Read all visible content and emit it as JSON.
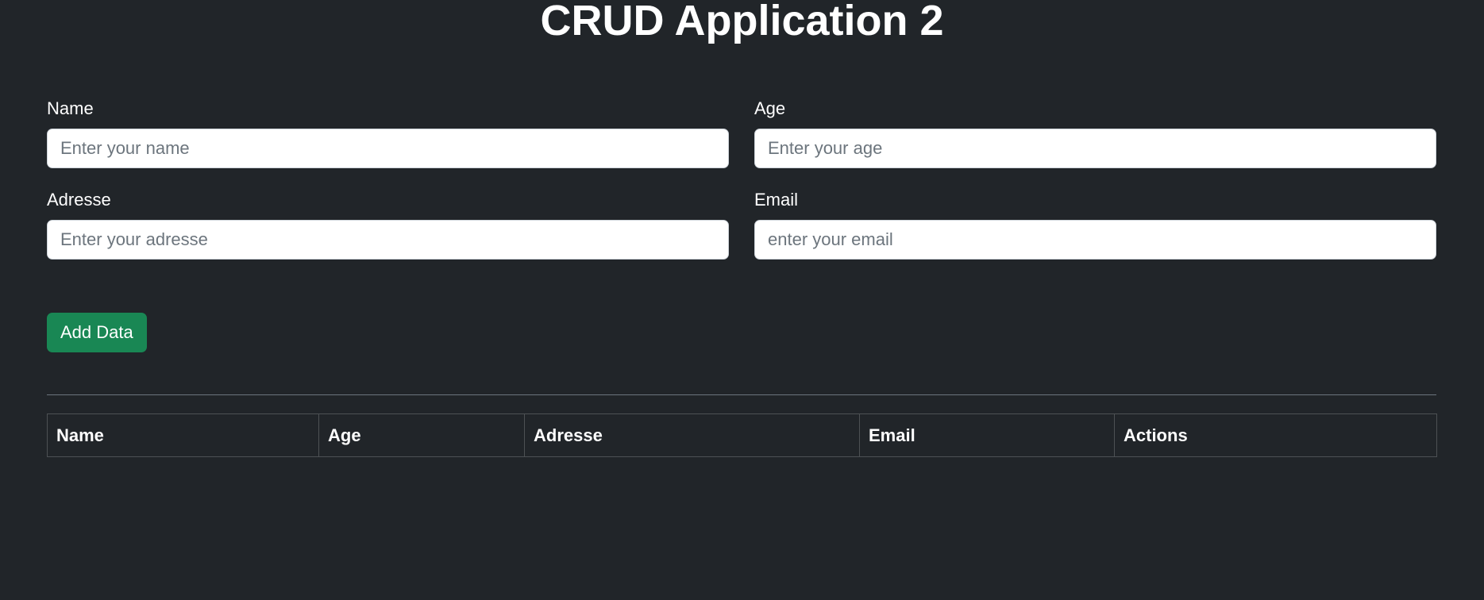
{
  "page": {
    "title": "CRUD Application 2"
  },
  "form": {
    "name": {
      "label": "Name",
      "placeholder": "Enter your name",
      "value": ""
    },
    "age": {
      "label": "Age",
      "placeholder": "Enter your age",
      "value": ""
    },
    "adresse": {
      "label": "Adresse",
      "placeholder": "Enter your adresse",
      "value": ""
    },
    "email": {
      "label": "Email",
      "placeholder": "enter your email",
      "value": ""
    },
    "submit_label": "Add Data"
  },
  "table": {
    "columns": [
      "Name",
      "Age",
      "Adresse",
      "Email",
      "Actions"
    ],
    "rows": []
  },
  "colors": {
    "background": "#212529",
    "button": "#198754",
    "text": "#ffffff"
  }
}
